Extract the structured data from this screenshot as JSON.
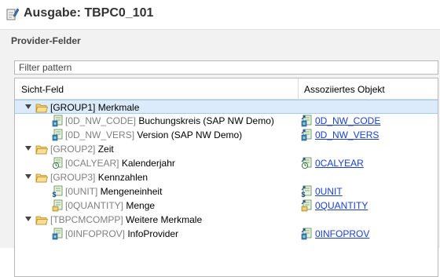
{
  "window": {
    "title": "Ausgabe: TBPC0_101",
    "icon": "pencil-edit-icon"
  },
  "section": {
    "title": "Provider-Felder"
  },
  "filter": {
    "placeholder": "Filter pattern"
  },
  "columns": {
    "view_field": "Sicht-Feld",
    "assoc_object": "Assoziiertes Objekt"
  },
  "groups": [
    {
      "code": "[GROUP1]",
      "name": "Merkmale",
      "selected": true,
      "expanded": true,
      "items": [
        {
          "code": "[0D_NW_CODE]",
          "name": "Buchungskreis (SAP NW Demo)",
          "icon": "characteristic-icon",
          "link": "0D_NW_CODE"
        },
        {
          "code": "[0D_NW_VERS]",
          "name": "Version (SAP NW Demo)",
          "icon": "characteristic-icon",
          "link": "0D_NW_VERS"
        }
      ]
    },
    {
      "code": "[GROUP2]",
      "name": "Zeit",
      "selected": false,
      "expanded": true,
      "items": [
        {
          "code": "[0CALYEAR]",
          "name": "Kalenderjahr",
          "icon": "time-characteristic-icon",
          "link": "0CALYEAR"
        }
      ]
    },
    {
      "code": "[GROUP3]",
      "name": "Kennzahlen",
      "selected": false,
      "expanded": true,
      "items": [
        {
          "code": "[0UNIT]",
          "name": "Mengeneinheit",
          "icon": "unit-icon",
          "link": "0UNIT"
        },
        {
          "code": "[0QUANTITY]",
          "name": "Menge",
          "icon": "key-figure-icon",
          "link": "0QUANTITY"
        }
      ]
    },
    {
      "code": "[TBPCMCOMPP]",
      "name": "Weitere Merkmale",
      "selected": false,
      "expanded": true,
      "items": [
        {
          "code": "[0INFOPROV]",
          "name": "InfoProvider",
          "icon": "characteristic-icon",
          "link": "0INFOPROV"
        }
      ]
    }
  ],
  "colors": {
    "link": "#1a3fd1",
    "selection": "#dcebfc",
    "folder": "#e8b84a"
  }
}
